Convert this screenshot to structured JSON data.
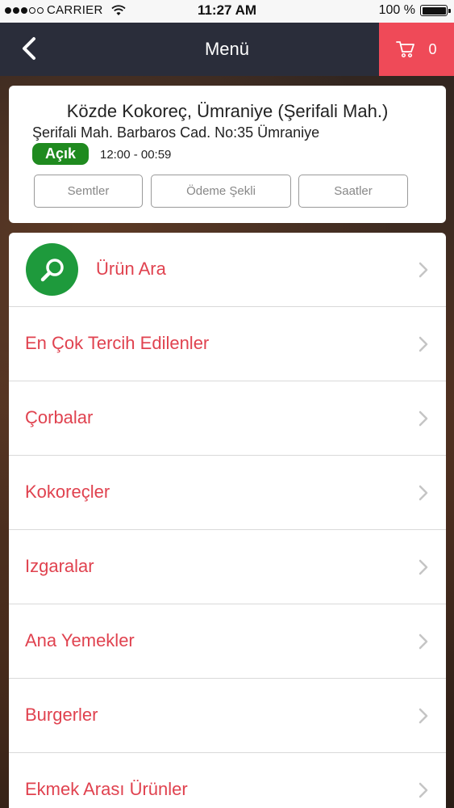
{
  "status_bar": {
    "carrier": "CARRIER",
    "time": "11:27 AM",
    "battery": "100 %"
  },
  "nav": {
    "title": "Menü",
    "cart_count": "0"
  },
  "restaurant": {
    "name": "Közde Kokoreç, Ümraniye (Şerifali Mah.)",
    "address": "Şerifali Mah. Barbaros Cad. No:35 Ümraniye",
    "status": "Açık",
    "hours": "12:00 - 00:59",
    "buttons": {
      "districts": "Semtler",
      "payment": "Ödeme Şekli",
      "hours": "Saatler"
    }
  },
  "menu": {
    "search_label": "Ürün Ara",
    "items": [
      "En Çok Tercih Edilenler",
      "Çorbalar",
      "Kokoreçler",
      "Izgaralar",
      "Ana Yemekler",
      "Burgerler",
      "Ekmek Arası Ürünler"
    ]
  },
  "colors": {
    "accent_red": "#ef4a58",
    "nav_dark": "#2a2d3a",
    "open_green": "#1f8a1f",
    "search_green": "#1e9a3c"
  }
}
